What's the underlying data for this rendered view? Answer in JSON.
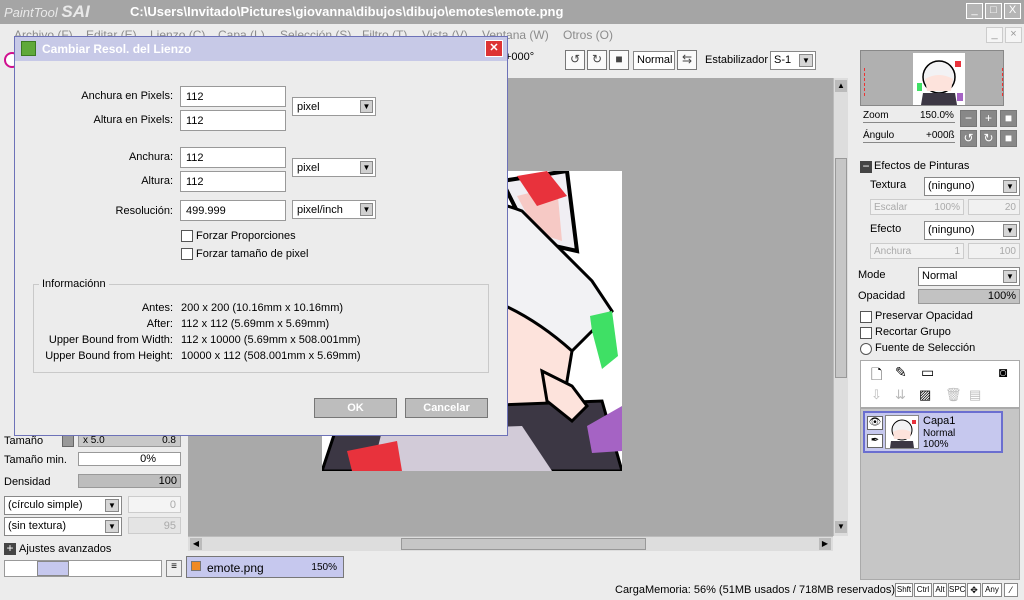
{
  "window": {
    "app_name": "PaintTool",
    "app_brand": "SAI",
    "path": "C:\\Users\\Invitado\\Pictures\\giovanna\\dibujos\\dibujo\\emotes\\emote.png",
    "min": "_",
    "max": "□",
    "close": "X"
  },
  "menu": [
    "Archivo (F)",
    "Editar (E)",
    "Lienzo (C)",
    "Capa (L)",
    "Selección (S)",
    "Filtro (T)",
    "Vista (V)",
    "Ventana (W)",
    "Otros (O)"
  ],
  "toolbar": {
    "angle": "+000°",
    "blend_mode": "Normal",
    "stabilizer_label": "Estabilizador",
    "stabilizer_value": "S-1"
  },
  "dialog": {
    "title": "Cambiar Resol. del Lienzo",
    "width_px_label": "Anchura en Pixels:",
    "width_px": "112",
    "height_px_label": "Altura en Pixels:",
    "height_px": "112",
    "unit1": "pixel",
    "width_label": "Anchura:",
    "width": "112",
    "height_label": "Altura:",
    "height": "112",
    "unit2": "pixel",
    "res_label": "Resolución:",
    "res": "499.999",
    "unit3": "pixel/inch",
    "force_prop": "Forzar Proporciones",
    "force_pixel": "Forzar tamaño de pixel",
    "info_title": "Informaciónn",
    "info": [
      {
        "k": "Antes:",
        "v": "200 x 200 (10.16mm x 10.16mm)"
      },
      {
        "k": "After:",
        "v": "112 x 112 (5.69mm x 5.69mm)"
      },
      {
        "k": "Upper Bound from Width:",
        "v": "112 x 10000 (5.69mm x 508.001mm)"
      },
      {
        "k": "Upper Bound from Height:",
        "v": "10000 x 112 (508.001mm x 5.69mm)"
      }
    ],
    "ok": "OK",
    "cancel": "Cancelar"
  },
  "left": {
    "tamano_label": "Tamaño",
    "tamano_mult": "x 5.0",
    "tamano_val": "0.8",
    "tamano_min_label": "Tamaño min.",
    "tamano_min_val": "0%",
    "densidad_label": "Densidad",
    "densidad_val": "100",
    "shape": "(círculo simple)",
    "shape_val": "0",
    "texture": "(sin textura)",
    "texture_val": "95",
    "advanced": "Ajustes avanzados"
  },
  "doc_tab": {
    "name": "emote.png",
    "zoom": "150%"
  },
  "nav": {
    "zoom_label": "Zoom",
    "zoom_val": "150.0%",
    "angle_label": "Ángulo",
    "angle_val": "+000ß"
  },
  "effects": {
    "title": "Efectos de Pinturas",
    "textura_label": "Textura",
    "textura_val": "(ninguno)",
    "escalar_label": "Escalar",
    "escalar_val": "100%",
    "escalar_num": "20",
    "efecto_label": "Efecto",
    "efecto_val": "(ninguno)",
    "anchura_label": "Anchura",
    "anchura_val": "1",
    "anchura_num": "100"
  },
  "layer_opts": {
    "mode_label": "Mode",
    "mode_val": "Normal",
    "opac_label": "Opacidad",
    "opac_val": "100%",
    "preserve": "Preservar Opacidad",
    "clip": "Recortar Grupo",
    "selsrc": "Fuente de Selección"
  },
  "layer": {
    "name": "Capa1",
    "mode": "Normal",
    "opacity": "100%"
  },
  "status": {
    "memory": "CargaMemoria: 56% (51MB usados / 718MB reservados)",
    "keys": [
      "Shft",
      "Ctrl",
      "Alt",
      "SPC",
      "✥",
      "Any",
      "⁄"
    ]
  }
}
